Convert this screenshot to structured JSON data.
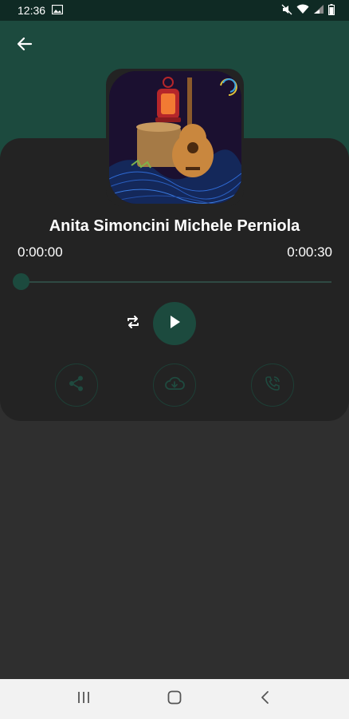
{
  "status_bar": {
    "time": "12:36",
    "icons": [
      "image-icon",
      "mute-icon",
      "wifi-icon",
      "signal-icon",
      "battery-icon"
    ]
  },
  "header": {
    "back_icon": "arrow-left-icon"
  },
  "player": {
    "cover_icon": "album-art-lantern-guitar",
    "title": "Anita Simoncini Michele Perniola",
    "current_time": "0:00:00",
    "total_time": "0:00:30",
    "progress": 0.0,
    "controls": {
      "repeat_icon": "repeat-icon",
      "play_icon": "play-icon"
    },
    "actions": [
      "share-icon",
      "cloud-download-icon",
      "phone-ringtone-icon"
    ]
  },
  "nav_bar": {
    "items": [
      "recents-icon",
      "home-icon",
      "back-icon"
    ]
  },
  "colors": {
    "accent": "#1c4a3e",
    "status_bar": "#0f2a24",
    "background": "#2f2f2f",
    "card": "#232323",
    "nav_bar": "#f2f2f2"
  }
}
